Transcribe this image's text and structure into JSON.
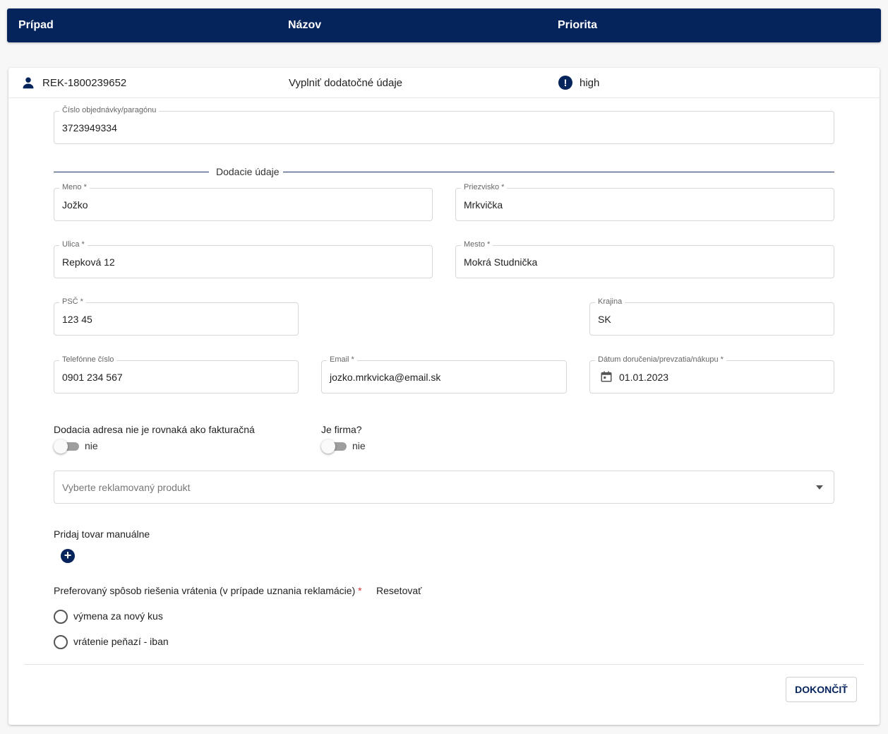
{
  "header": {
    "col1": "Prípad",
    "col2": "Názov",
    "col3": "Priorita"
  },
  "case": {
    "id": "REK-1800239652",
    "name": "Vyplniť dodatočné údaje",
    "priority": "high",
    "priority_icon": "exclamation-circle-icon",
    "person_icon": "person-icon"
  },
  "order": {
    "label": "Číslo objednávky/paragónu",
    "value": "3723949334"
  },
  "delivery": {
    "title": "Dodacie údaje",
    "first_name": {
      "label": "Meno *",
      "value": "Jožko"
    },
    "last_name": {
      "label": "Priezvisko *",
      "value": "Mrkvička"
    },
    "street": {
      "label": "Ulica *",
      "value": "Repková 12"
    },
    "city": {
      "label": "Mesto *",
      "value": "Mokrá Studnička"
    },
    "zip": {
      "label": "PSČ *",
      "value": "123 45"
    },
    "country": {
      "label": "Krajina",
      "value": "SK"
    },
    "phone": {
      "label": "Telefónne číslo",
      "value": "0901 234 567"
    },
    "email": {
      "label": "Email *",
      "value": "jozko.mrkvicka@email.sk"
    },
    "date": {
      "label": "Dátum doručenia/prevzatia/nákupu *",
      "value": "01.01.2023"
    }
  },
  "toggles": {
    "billing": {
      "label": "Dodacia adresa nie je rovnaká ako fakturačná",
      "state": "nie"
    },
    "company": {
      "label": "Je firma?",
      "state": "nie"
    }
  },
  "product_select": {
    "placeholder": "Vyberte reklamovaný produkt"
  },
  "manual": {
    "label": "Pridaj tovar manuálne"
  },
  "resolution": {
    "label": "Preferovaný spôsob riešenia vrátenia (v prípade uznania reklamácie)",
    "required": "*",
    "reset": "Resetovať",
    "options": [
      "výmena za nový kus",
      "vrátenie peňazí - iban"
    ]
  },
  "actions": {
    "finish": "DOKONČIŤ"
  },
  "colors": {
    "brand": "#06245c"
  }
}
